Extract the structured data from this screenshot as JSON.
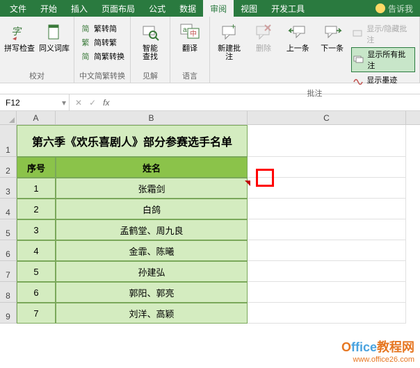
{
  "menus": {
    "file": "文件",
    "home": "开始",
    "insert": "插入",
    "layout": "页面布局",
    "formulas": "公式",
    "data": "数据",
    "review": "审阅",
    "view": "视图",
    "dev": "开发工具",
    "tellme": "告诉我"
  },
  "ribbon": {
    "proofing": {
      "label": "校对",
      "spell": "拼写检查",
      "thesaurus": "同义词库"
    },
    "chinese": {
      "label": "中文简繁转换",
      "toSimp": "繁转简",
      "toTrad": "简转繁",
      "convert": "简繁转换"
    },
    "insights": {
      "label": "见解",
      "smart": "智能\n查找"
    },
    "lang": {
      "label": "语言",
      "translate": "翻译"
    },
    "comments": {
      "label": "批注",
      "new": "新建批注",
      "del": "删除",
      "prev": "上一条",
      "next": "下一条",
      "showhide": "显示/隐藏批注",
      "showall": "显示所有批注",
      "ink": "显示墨迹"
    }
  },
  "namebox": "F12",
  "cols": {
    "a": "A",
    "b": "B",
    "c": "C"
  },
  "rows": [
    "1",
    "2",
    "3",
    "4",
    "5",
    "6",
    "7",
    "8",
    "9"
  ],
  "table": {
    "title": "第六季《欢乐喜剧人》部分参赛选手名单",
    "h1": "序号",
    "h2": "姓名",
    "rows": [
      {
        "n": "1",
        "name": "张霜剑"
      },
      {
        "n": "2",
        "name": "白鸽"
      },
      {
        "n": "3",
        "name": "孟鹤堂、周九良"
      },
      {
        "n": "4",
        "name": "金霏、陈曦"
      },
      {
        "n": "5",
        "name": "孙建弘"
      },
      {
        "n": "6",
        "name": "郭阳、郭亮"
      },
      {
        "n": "7",
        "name": "刘洋、高颖"
      }
    ]
  },
  "watermark": {
    "brand": "Office教程网",
    "url": "www.office26.com"
  }
}
